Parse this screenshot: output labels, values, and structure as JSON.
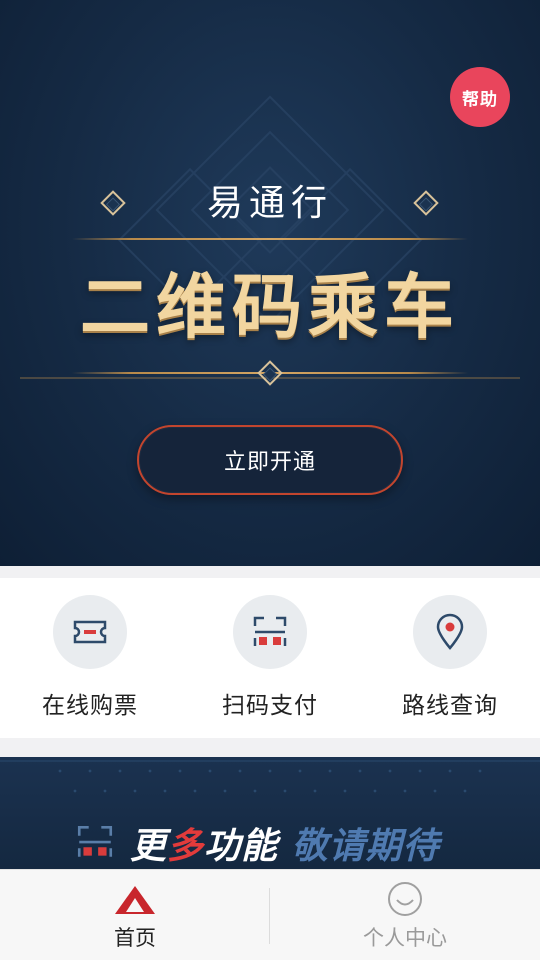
{
  "hero": {
    "help_label": "帮助",
    "brand": "易通行",
    "title": "二维码乘车",
    "open_button": "立即开通"
  },
  "services": [
    {
      "label": "在线购票",
      "icon": "ticket-icon"
    },
    {
      "label": "扫码支付",
      "icon": "scan-code-icon"
    },
    {
      "label": "路线查询",
      "icon": "location-pin-icon"
    }
  ],
  "promo": {
    "part1": "更",
    "part2": "多",
    "part3": "功能",
    "part4": "敬请期待",
    "icon": "scan-code-icon"
  },
  "tabbar": {
    "home_label": "首页",
    "profile_label": "个人中心",
    "home_icon": "home-triangle-icon",
    "profile_icon": "smiley-icon"
  },
  "colors": {
    "hero_bg": "#152a44",
    "gold": "#f2d6a0",
    "help_red": "#e9455c",
    "accent_red": "#c2452e",
    "active_tab": "#c8262c",
    "inactive_tab": "#9a9a9a"
  }
}
